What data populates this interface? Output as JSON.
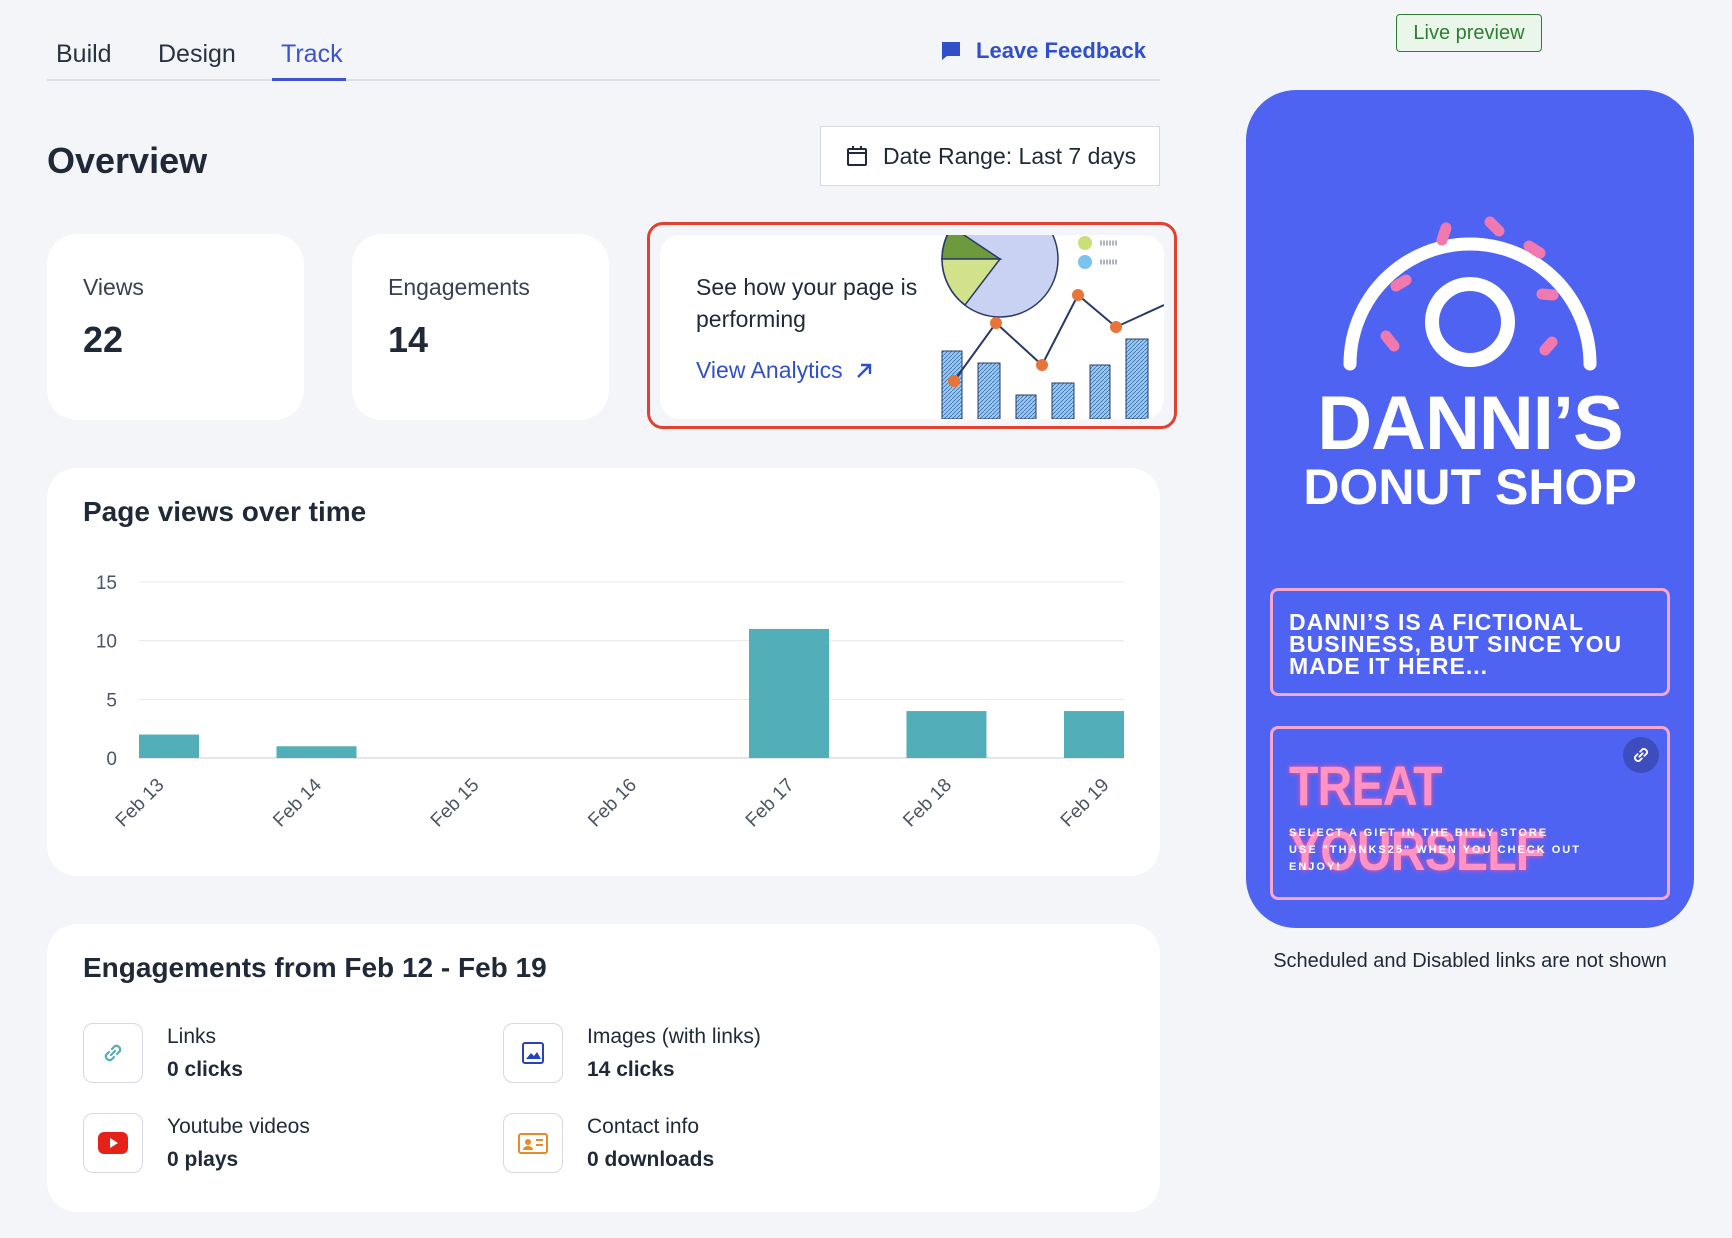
{
  "tabs": [
    {
      "label": "Build"
    },
    {
      "label": "Design"
    },
    {
      "label": "Track"
    }
  ],
  "feedback": {
    "label": "Leave Feedback"
  },
  "overview": {
    "title": "Overview"
  },
  "date_range": {
    "label": "Date Range: Last 7 days"
  },
  "stats": {
    "views": {
      "label": "Views",
      "value": "22"
    },
    "engagements": {
      "label": "Engagements",
      "value": "14"
    }
  },
  "promo": {
    "text": "See how your page is performing",
    "link": "View Analytics"
  },
  "page_views_chart": {
    "title": "Page views over time"
  },
  "chart_data": {
    "type": "bar",
    "title": "Page views over time",
    "categories": [
      "Feb 13",
      "Feb 14",
      "Feb 15",
      "Feb 16",
      "Feb 17",
      "Feb 18",
      "Feb 19"
    ],
    "values": [
      2,
      1,
      0,
      0,
      11,
      4,
      4
    ],
    "yticks": [
      "0",
      "5",
      "10",
      "15"
    ],
    "ylim": [
      0,
      15
    ],
    "grid": true,
    "color": "#52aeb8"
  },
  "engagements": {
    "title": "Engagements from Feb 12 - Feb 19",
    "items": [
      {
        "label": "Links",
        "value": "0 clicks",
        "icon": "link-icon"
      },
      {
        "label": "Images (with links)",
        "value": "14 clicks",
        "icon": "image-icon"
      },
      {
        "label": "Youtube videos",
        "value": "0 plays",
        "icon": "youtube-icon"
      },
      {
        "label": "Contact info",
        "value": "0 downloads",
        "icon": "contact-card-icon"
      }
    ]
  },
  "preview": {
    "badge": "Live preview",
    "brand_line1": "DANNI’S",
    "brand_line2": "DONUT SHOP",
    "link1": [
      "DANNI’S IS A FICTIONAL",
      "BUSINESS, BUT SINCE YOU",
      "MADE IT HERE..."
    ],
    "link2_title": "TREAT YOURSELF",
    "link2_lines": [
      "SELECT A GIFT IN THE BITLY STORE",
      "USE \"THANKS25\" WHEN YOU CHECK OUT",
      "ENJOY!"
    ],
    "note": "Scheduled and Disabled links are not shown"
  },
  "colors": {
    "accent": "#3d53cf",
    "phone_bg": "#4f63f2",
    "bar": "#52aeb8",
    "highlight": "#e04131"
  }
}
